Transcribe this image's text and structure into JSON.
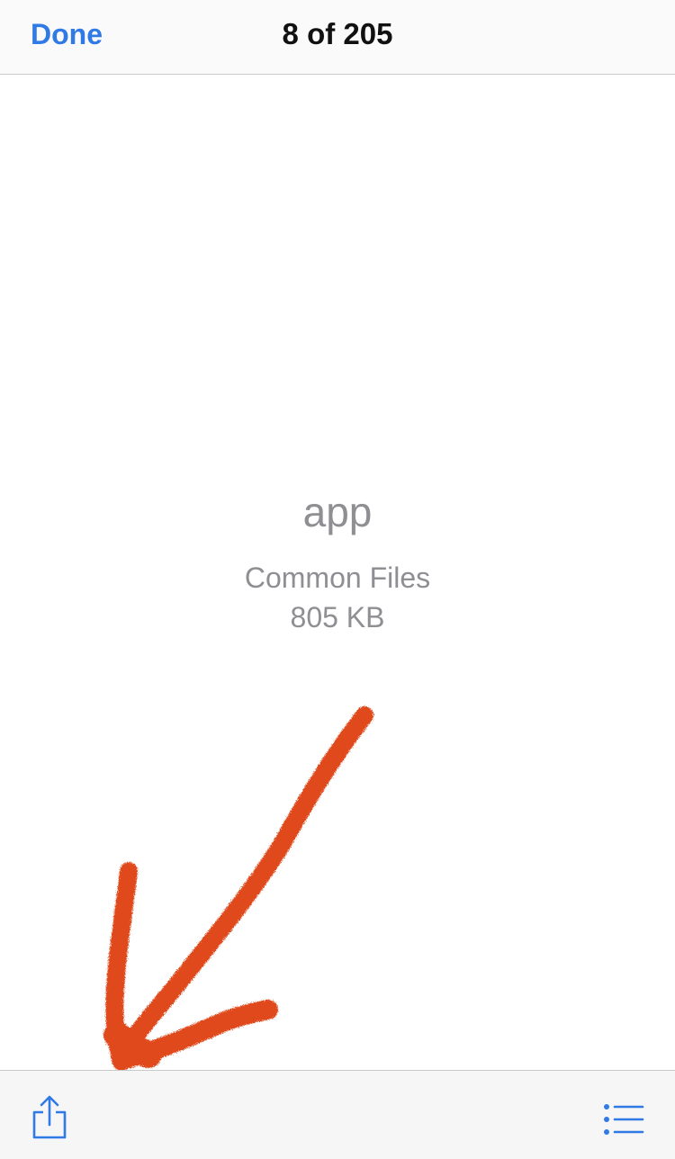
{
  "nav": {
    "done_label": "Done",
    "counter": "8 of 205"
  },
  "file": {
    "name": "app",
    "location": "Common Files",
    "size": "805 KB"
  },
  "toolbar": {
    "share_icon": "share-icon",
    "list_icon": "list-icon"
  },
  "colors": {
    "accent": "#2f7ae5",
    "secondary_text": "#8e8e93",
    "annotation": "#e04a1b"
  }
}
